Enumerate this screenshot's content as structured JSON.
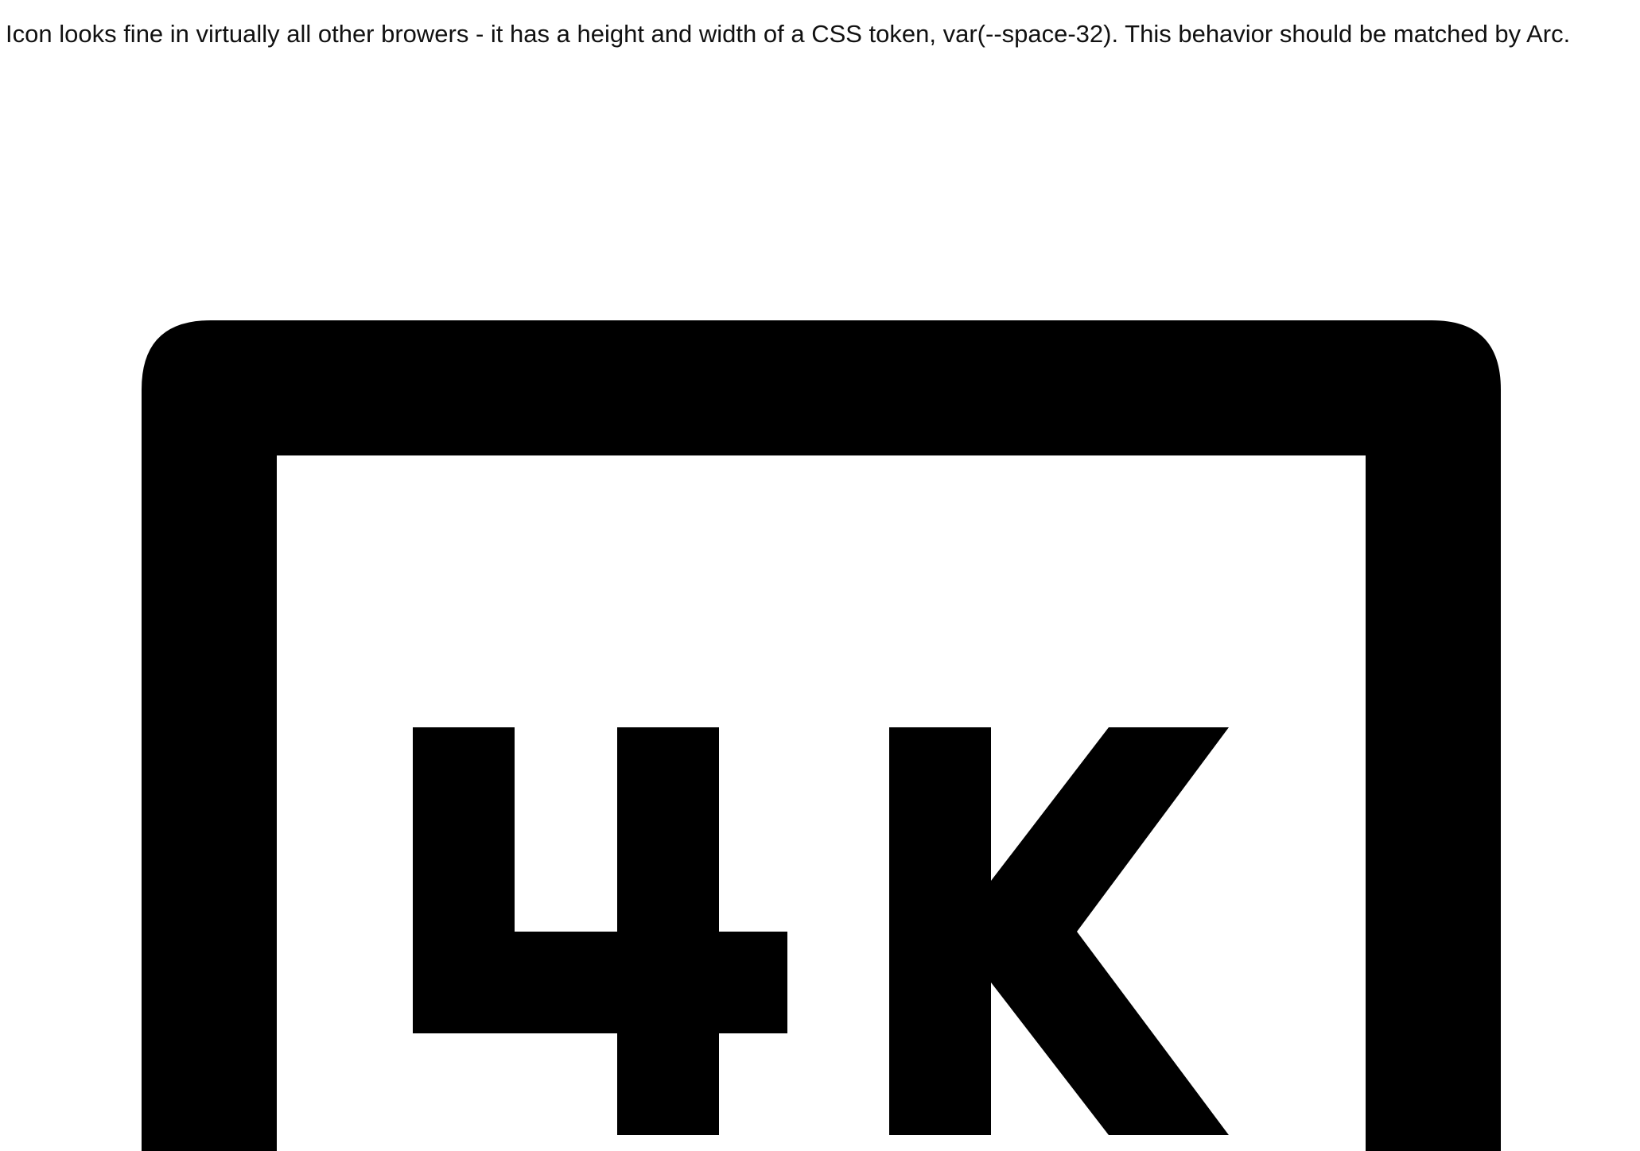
{
  "content": {
    "description": "Icon looks fine in virtually all other browers - it has a height and width of a CSS token, var(--space-32). This behavior should be matched by Arc."
  },
  "icon": {
    "name": "4k-icon",
    "color": "#000000",
    "background": "#ffffff"
  }
}
